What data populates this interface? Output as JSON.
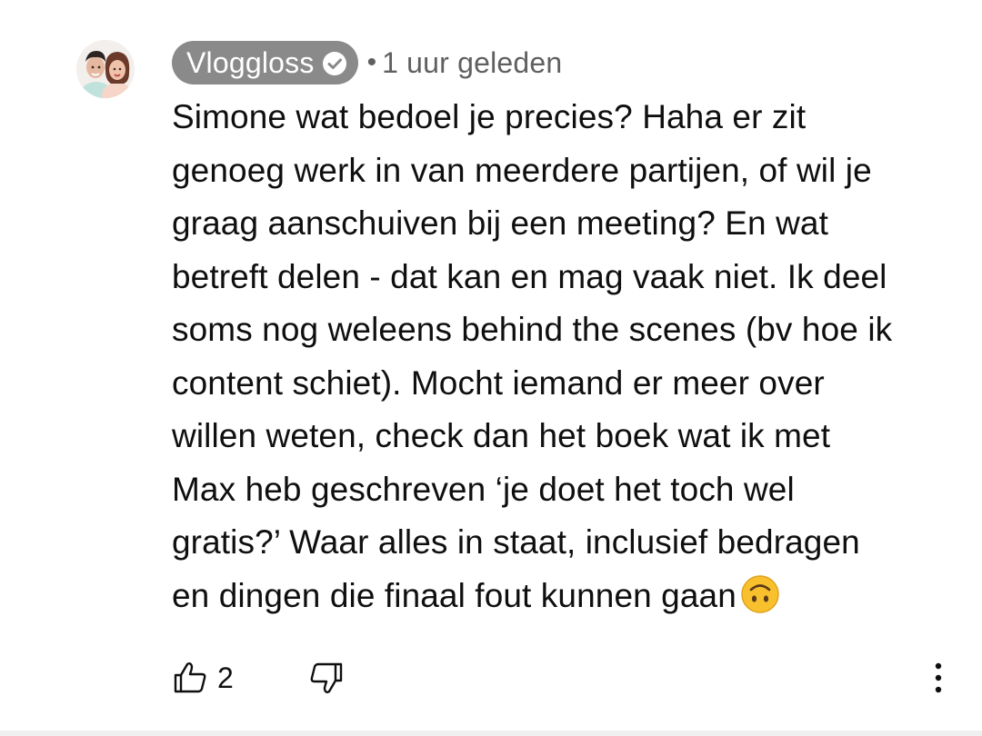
{
  "comment": {
    "author": "Vloggloss",
    "verified_icon": "verified-check-icon",
    "separator": "•",
    "timestamp": "1 uur geleden",
    "text": "Simone wat bedoel je precies? Haha er zit\ngenoeg werk in van meerdere partijen, of wil je\ngraag aanschuiven bij een meeting? En wat\nbetreft delen - dat kan en mag vaak niet. Ik deel\nsoms nog weleens behind the scenes (bv hoe ik\ncontent schiet). Mocht iemand er meer over\nwillen weten, check dan het boek wat ik met\nMax heb geschreven ‘je doet het toch wel\ngratis?’ Waar alles in staat, inclusief bedragen\nen dingen die finaal fout kunnen gaan",
    "emoji_icon": "upside-down-face-emoji",
    "like_count": "2"
  },
  "icons": {
    "like": "thumbs-up-icon",
    "dislike": "thumbs-down-icon",
    "more": "more-vertical-icon"
  },
  "colors": {
    "author_chip_bg": "#8a8a8a",
    "secondary_text": "#606060",
    "primary_text": "#0f0f0f",
    "emoji_yellow": "#f9c02e"
  }
}
